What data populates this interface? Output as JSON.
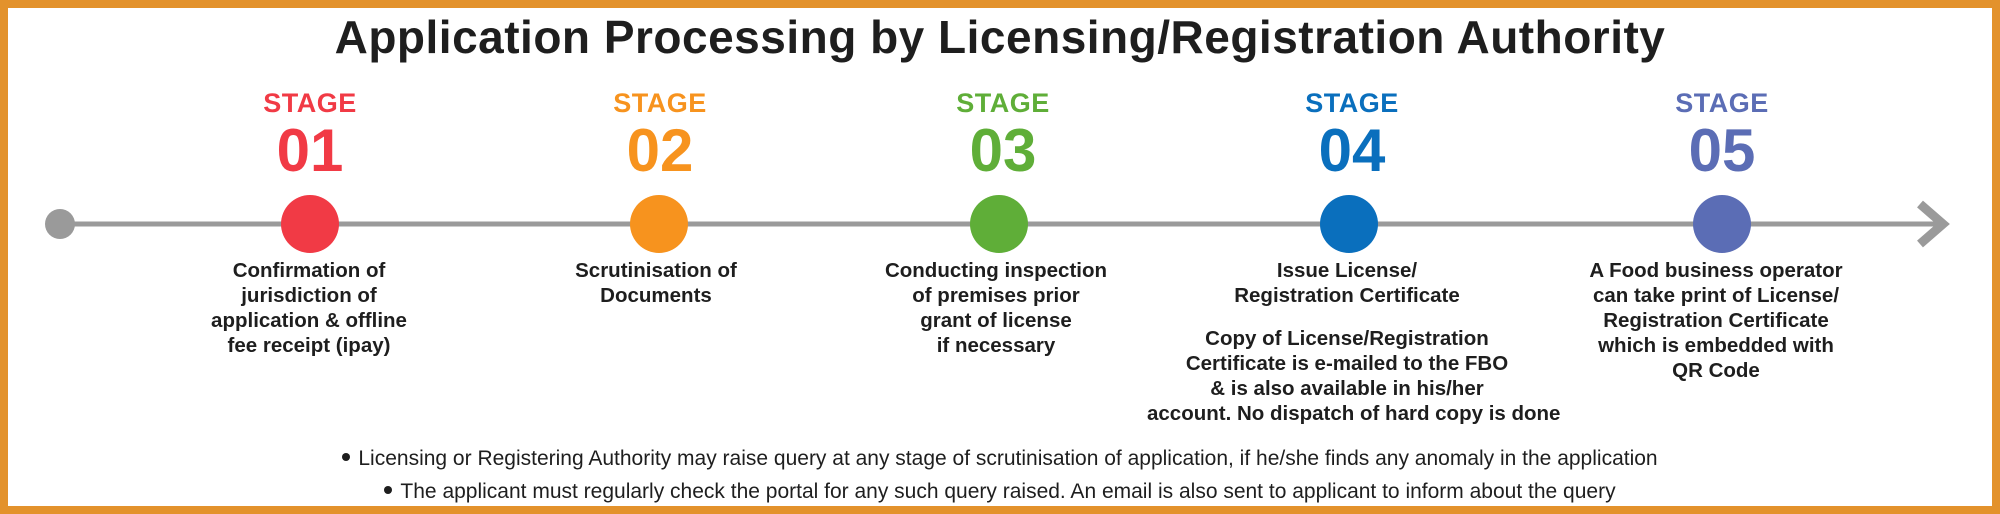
{
  "title": "Application Processing by Licensing/Registration Authority",
  "colors": {
    "border": "#e3922c",
    "line": "#9a9a9a",
    "text": "#1e1e1e"
  },
  "stages": [
    {
      "label": "STAGE",
      "number": "01",
      "color": "#f13a45",
      "description": [
        "Confirmation of",
        "jurisdiction of",
        "application & offline",
        "fee receipt (ipay)"
      ]
    },
    {
      "label": "STAGE",
      "number": "02",
      "color": "#f7931e",
      "description": [
        "Scrutinisation of",
        "Documents"
      ]
    },
    {
      "label": "STAGE",
      "number": "03",
      "color": "#5fae38",
      "description": [
        "Conducting inspection",
        "of premises prior",
        "grant of license",
        "if necessary"
      ]
    },
    {
      "label": "STAGE",
      "number": "04",
      "color": "#0a6fbd",
      "description": [
        "Issue License/",
        "Registration Certificate"
      ],
      "extra": [
        "Copy of License/Registration",
        "Certificate is e-mailed to the FBO",
        "& is also available in his/her",
        "account. No dispatch of hard copy is done"
      ]
    },
    {
      "label": "STAGE",
      "number": "05",
      "color": "#5b6db5",
      "description": [
        "A Food business operator",
        "can take print of License/",
        "Registration Certificate",
        "which is embedded with",
        "QR Code"
      ]
    }
  ],
  "notes": [
    "Licensing or Registering Authority may raise query at any stage of scrutinisation of application, if he/she finds any anomaly in the application",
    "The applicant must regularly check the portal for any such query raised. An email is also sent to applicant to inform about the query"
  ]
}
